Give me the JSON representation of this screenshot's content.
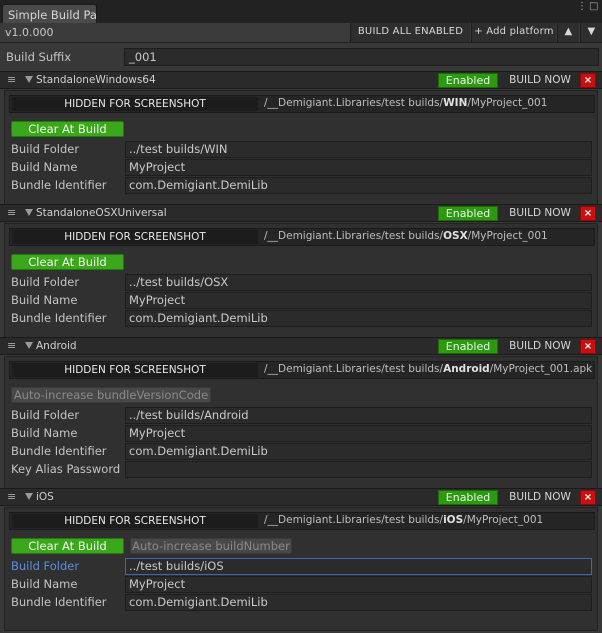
{
  "window": {
    "tab_title": "Simple Build Pa",
    "menu_glyph": "⋮",
    "maximize_glyph": "□",
    "close_glyph": "×"
  },
  "toolbar": {
    "version": "v1.0.000",
    "build_all_label": "BUILD ALL ENABLED",
    "add_platform_label": "+ Add platform",
    "move_up_label": "▲",
    "move_down_label": "▼"
  },
  "build_suffix": {
    "label": "Build Suffix",
    "value": "_001"
  },
  "platforms": [
    {
      "name": "StandaloneWindows64",
      "enabled_label": "Enabled",
      "build_now_label": "BUILD NOW",
      "close_label": "×",
      "hidden_label": "HIDDEN FOR SCREENSHOT",
      "path_prefix": "/__Demigiant.Libraries/test builds/",
      "path_folder": "WIN",
      "path_file": "/MyProject_001",
      "clear_at_build_label": "Clear At Build",
      "fields": [
        {
          "label": "Build Folder",
          "value": "../test builds/WIN"
        },
        {
          "label": "Build Name",
          "value": "MyProject"
        },
        {
          "label": "Bundle Identifier",
          "value": "com.Demigiant.DemiLib"
        }
      ]
    },
    {
      "name": "StandaloneOSXUniversal",
      "enabled_label": "Enabled",
      "build_now_label": "BUILD NOW",
      "close_label": "×",
      "hidden_label": "HIDDEN FOR SCREENSHOT",
      "path_prefix": "/__Demigiant.Libraries/test builds/",
      "path_folder": "OSX",
      "path_file": "/MyProject_001",
      "clear_at_build_label": "Clear At Build",
      "fields": [
        {
          "label": "Build Folder",
          "value": "../test builds/OSX"
        },
        {
          "label": "Build Name",
          "value": "MyProject"
        },
        {
          "label": "Bundle Identifier",
          "value": "com.Demigiant.DemiLib"
        }
      ]
    },
    {
      "name": "Android",
      "enabled_label": "Enabled",
      "build_now_label": "BUILD NOW",
      "close_label": "×",
      "hidden_label": "HIDDEN FOR SCREENSHOT",
      "path_prefix": "/__Demigiant.Libraries/test builds/",
      "path_folder": "Android",
      "path_file": "/MyProject_001.apk",
      "auto_increase_label": "Auto-increase bundleVersionCode",
      "fields": [
        {
          "label": "Build Folder",
          "value": "../test builds/Android"
        },
        {
          "label": "Build Name",
          "value": "MyProject"
        },
        {
          "label": "Bundle Identifier",
          "value": "com.Demigiant.DemiLib"
        },
        {
          "label": "Key Alias Password",
          "value": ""
        }
      ]
    },
    {
      "name": "iOS",
      "enabled_label": "Enabled",
      "build_now_label": "BUILD NOW",
      "close_label": "×",
      "hidden_label": "HIDDEN FOR SCREENSHOT",
      "path_prefix": "/__Demigiant.Libraries/test builds/",
      "path_folder": "iOS",
      "path_file": "/MyProject_001",
      "clear_at_build_label": "Clear At Build",
      "auto_increase_label": "Auto-increase buildNumber",
      "fields": [
        {
          "label": "Build Folder",
          "value": "../test builds/iOS"
        },
        {
          "label": "Build Name",
          "value": "MyProject"
        },
        {
          "label": "Bundle Identifier",
          "value": "com.Demigiant.DemiLib"
        }
      ]
    }
  ],
  "colors": {
    "enabled_green": "#2a9a0e",
    "close_red": "#c81010",
    "focus_blue": "#3a64c0"
  }
}
